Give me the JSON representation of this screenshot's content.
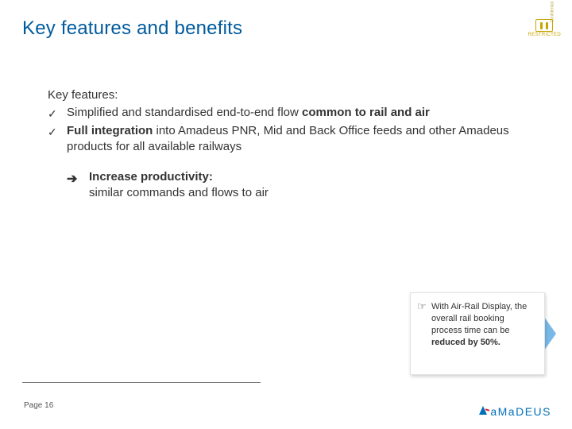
{
  "title": "Key features and benefits",
  "labels": {
    "confidential": "Confidential",
    "restricted": "RESTRICTED"
  },
  "features": {
    "heading": "Key features:",
    "items": [
      {
        "pre": "Simplified and standardised end-to-end flow",
        "bold": "common to rail and air"
      },
      {
        "bold": "Full integration",
        "post": "into Amadeus PNR, Mid and Back Office feeds and other Amadeus products for all available railways"
      }
    ]
  },
  "benefit": {
    "bold": "Increase productivity:",
    "line": "similar commands and flows to air"
  },
  "callout": {
    "pre": "With Air-Rail Display, the overall rail booking process time can be",
    "bold": "reduced by 50%."
  },
  "footer": {
    "page_label": "Page",
    "page_number": "16",
    "brand": "aMaDEUS"
  }
}
